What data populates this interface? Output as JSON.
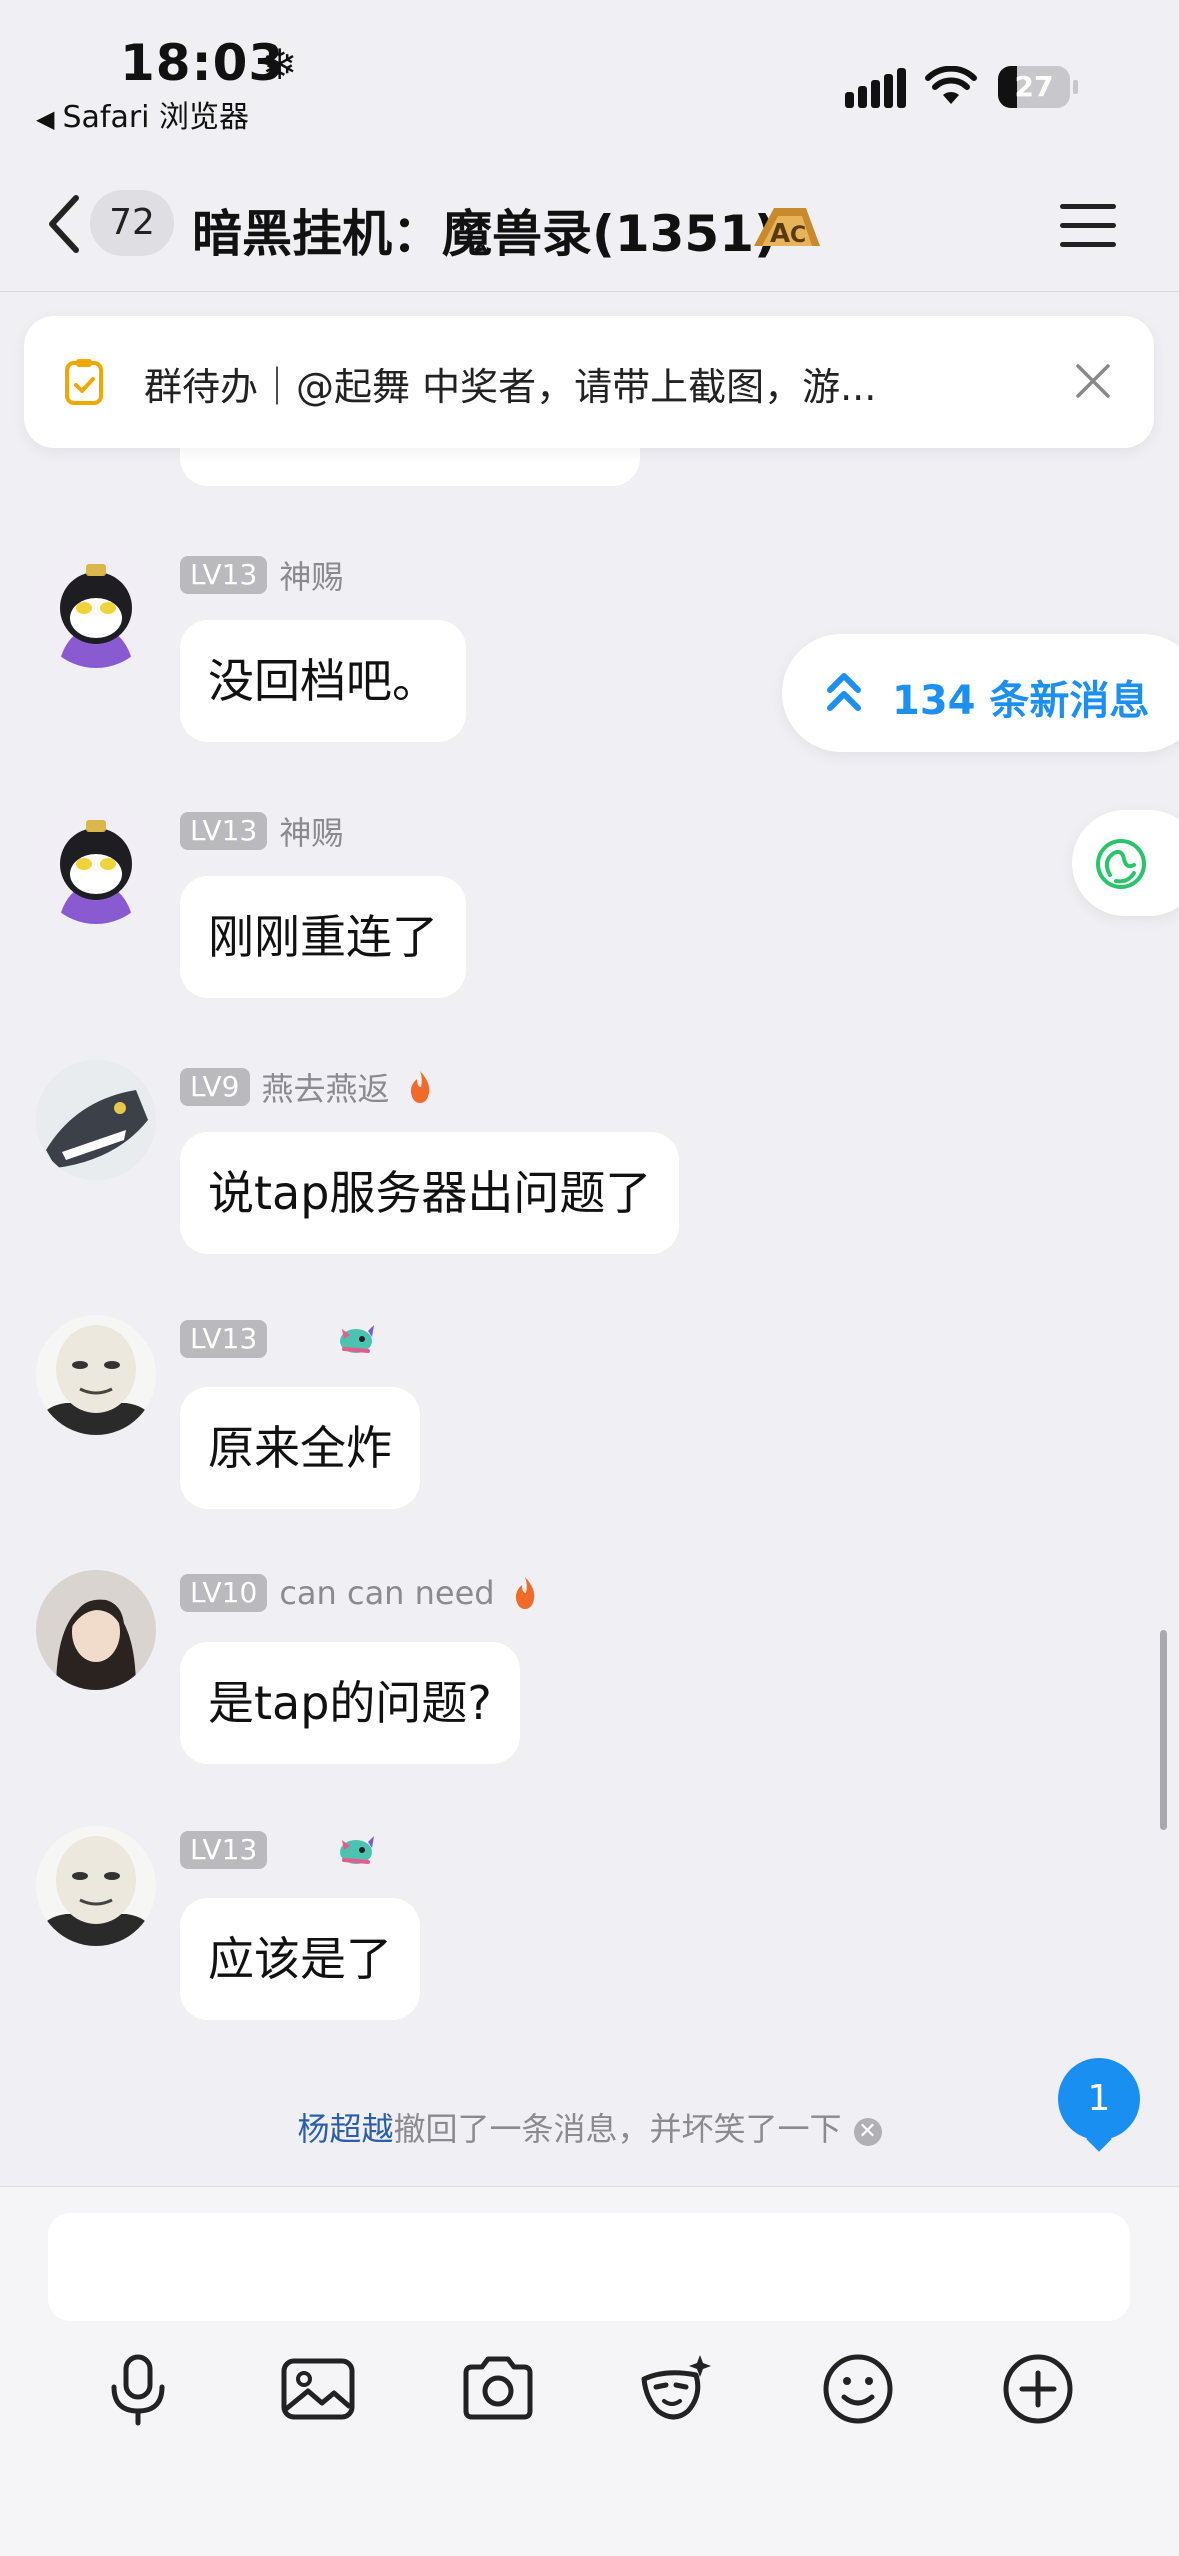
{
  "status_bar": {
    "time": "18:03",
    "back_app_label": "Safari 浏览器",
    "battery_level": "27"
  },
  "nav": {
    "unread_count": "72",
    "title": "暗黑挂机：魔兽录(1351)"
  },
  "todo_banner": {
    "text": "群待办｜@起舞 中奖者，请带上截图，游..."
  },
  "new_messages_pill": {
    "label": "134 条新消息"
  },
  "messages": [
    {
      "level": "LV13",
      "sender": "神赐",
      "text": "没回档吧。"
    },
    {
      "level": "LV13",
      "sender": "神赐",
      "text": "刚刚重连了"
    },
    {
      "level": "LV9",
      "sender": "燕去燕返",
      "text": "说tap服务器出问题了"
    },
    {
      "level": "LV13",
      "sender": "",
      "text": "原来全炸"
    },
    {
      "level": "LV10",
      "sender": "can can need",
      "text": "是tap的问题?"
    },
    {
      "level": "LV13",
      "sender": "",
      "text": "应该是了"
    }
  ],
  "recall_notice": {
    "name": "杨超越",
    "text": "撤回了一条消息，并坏笑了一下"
  },
  "unread_mention_count": "1",
  "colors": {
    "accent_blue": "#1c8ff0",
    "background": "#efeff4",
    "level_badge": "#b9b9be"
  },
  "toolbar_icons": [
    "microphone-icon",
    "image-icon",
    "camera-icon",
    "sticker-icon",
    "emoji-icon",
    "plus-icon"
  ]
}
